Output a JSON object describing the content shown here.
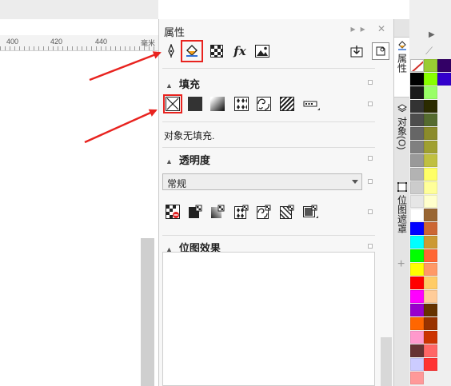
{
  "ruler": {
    "ticks": [
      "400",
      "420",
      "440"
    ],
    "unit": "毫米"
  },
  "panel": {
    "title": "属性",
    "title_buttons": "▸▸ ✕",
    "toolbar_icons": [
      "outline-pen-icon",
      "fill-bucket-icon",
      "transparency-icon",
      "effects-fx-icon",
      "bitmap-image-icon",
      "apply-icon",
      "object-properties-icon"
    ],
    "fx_label": "fx"
  },
  "fill": {
    "header": "填充",
    "status": "对象无填充.",
    "types": [
      "no-fill",
      "uniform-fill",
      "fountain-fill",
      "vector-pattern-fill",
      "bitmap-pattern-fill",
      "two-color-pattern-fill",
      "postscript-fill"
    ]
  },
  "transparency": {
    "header": "透明度",
    "mode": "常规",
    "types": [
      "no-transparency",
      "uniform-transparency",
      "fountain-transparency",
      "vector-pattern-transparency",
      "bitmap-pattern-transparency",
      "two-color-transparency",
      "texture-transparency"
    ]
  },
  "bitmap_effects": {
    "header": "位图效果"
  },
  "side_tabs": [
    "属性",
    "对象(O)",
    "位图遮罩"
  ],
  "palette": {
    "colors": {
      "col1": [
        "#000000",
        "#1a1a1a",
        "#333333",
        "#4d4d4d",
        "#666666",
        "#808080",
        "#999999",
        "#b3b3b3",
        "#cccccc",
        "#e6e6e6",
        "#ffffff",
        "#0000ff",
        "#00ffff",
        "#00ff00",
        "#ffff00",
        "#ff0000",
        "#ff00ff",
        "#9900cc",
        "#ff6600",
        "#ff99cc",
        "#663333",
        "#ccccff",
        "#ff9999"
      ],
      "col2": [
        "#99cc33",
        "#88ff00",
        "#99ff66",
        "#2b2b00",
        "#556b2f",
        "#8b8b2b",
        "#a0a030",
        "#c0c040",
        "#ffff66",
        "#ffff99",
        "#ffffcc",
        "#996633",
        "#cc6633",
        "#cc9933",
        "#ff6633",
        "#ff9966",
        "#ffcc66",
        "#ffcc99",
        "#663300",
        "#993300",
        "#cc3300",
        "#ff6666",
        "#ff3333"
      ],
      "top": [
        "#330066",
        "#3300cc"
      ]
    }
  }
}
